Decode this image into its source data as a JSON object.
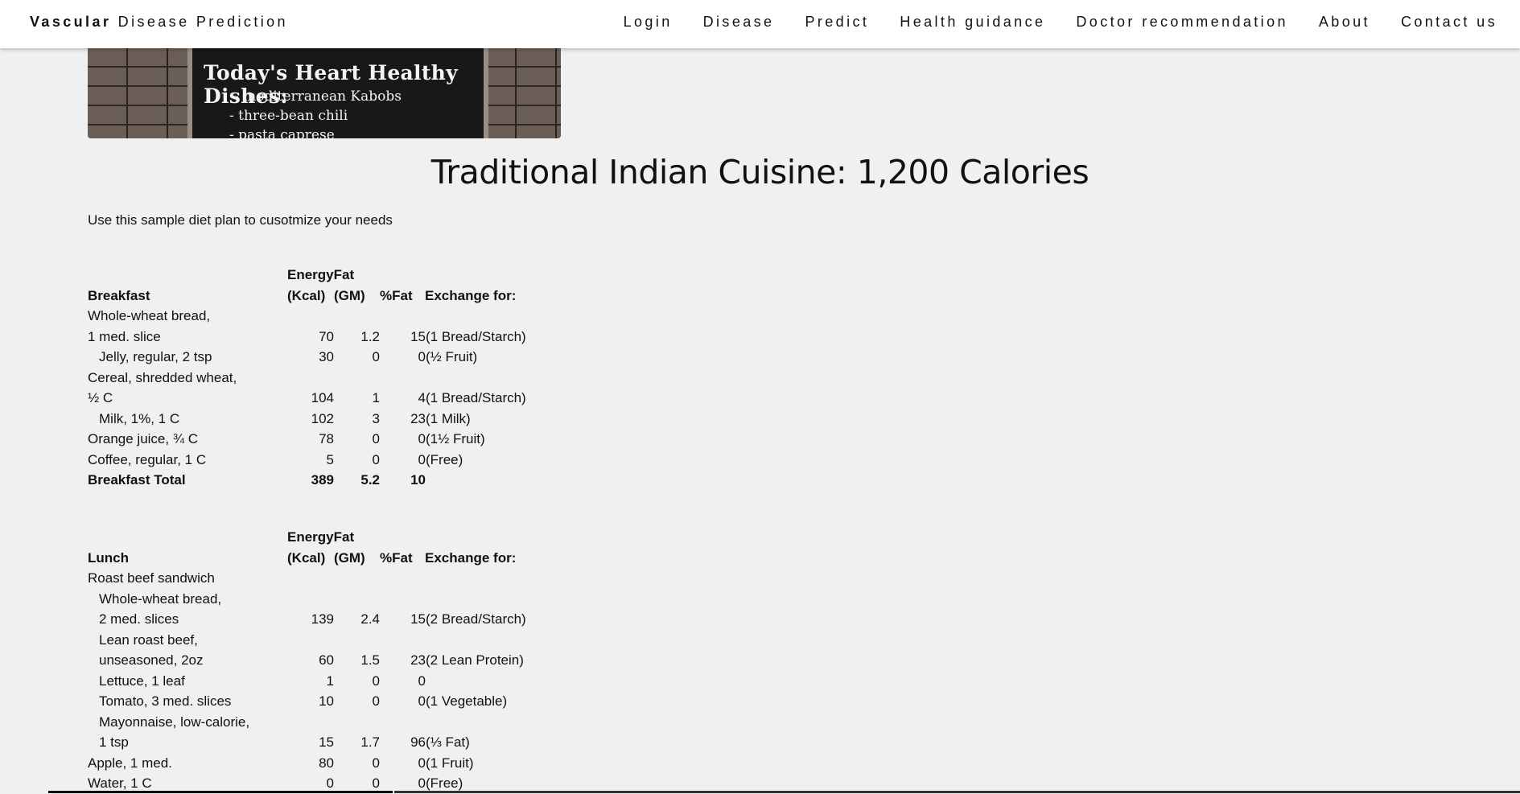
{
  "navbar": {
    "brand_bold": "Vascular",
    "brand_rest": " Disease Prediction",
    "links": [
      "Login",
      "Disease",
      "Predict",
      "Health guidance",
      "Doctor recommendation",
      "About",
      "Contact us"
    ]
  },
  "hero": {
    "title": "Today's Heart Healthy Dishes:",
    "items": [
      "- mediterranean Kabobs",
      "- three-bean chili",
      "- pasta caprese"
    ]
  },
  "page": {
    "title": "Traditional Indian Cuisine: 1,200 Calories",
    "intro": "Use this sample diet plan to cusotmize your needs"
  },
  "headers": {
    "energy_fat": "EnergyFat",
    "kcal": "(Kcal)",
    "gm": "(GM)",
    "pct_fat": "%Fat",
    "exchange": "Exchange for:"
  },
  "breakfast": {
    "label": "Breakfast",
    "rows": [
      {
        "name": "Whole-wheat bread,",
        "indent": false,
        "kcal": "",
        "fat": "",
        "pct": "",
        "ex": ""
      },
      {
        "name": "1 med. slice",
        "indent": false,
        "kcal": "70",
        "fat": "1.2",
        "pct": "15",
        "ex": "(1 Bread/Starch)"
      },
      {
        "name": "Jelly, regular, 2 tsp",
        "indent": true,
        "kcal": "30",
        "fat": "0",
        "pct": "0",
        "ex": "(½ Fruit)"
      },
      {
        "name": "Cereal, shredded wheat,",
        "indent": false,
        "kcal": "",
        "fat": "",
        "pct": "",
        "ex": ""
      },
      {
        "name": "½ C",
        "indent": false,
        "kcal": "104",
        "fat": "1",
        "pct": "4",
        "ex": "(1 Bread/Starch)"
      },
      {
        "name": "Milk, 1%, 1 C",
        "indent": true,
        "kcal": "102",
        "fat": "3",
        "pct": "23",
        "ex": "(1 Milk)"
      },
      {
        "name": "Orange juice, ¾ C",
        "indent": false,
        "kcal": "78",
        "fat": "0",
        "pct": "0",
        "ex": "(1½ Fruit)"
      },
      {
        "name": "Coffee, regular, 1 C",
        "indent": false,
        "kcal": "5",
        "fat": "0",
        "pct": "0",
        "ex": "(Free)"
      }
    ],
    "total": {
      "name": "Breakfast Total",
      "kcal": "389",
      "fat": "5.2",
      "pct": "10"
    }
  },
  "lunch": {
    "label": "Lunch",
    "rows": [
      {
        "name": "Roast beef sandwich",
        "indent": false,
        "kcal": "",
        "fat": "",
        "pct": "",
        "ex": ""
      },
      {
        "name": "Whole-wheat bread,",
        "indent": true,
        "kcal": "",
        "fat": "",
        "pct": "",
        "ex": ""
      },
      {
        "name": "2 med. slices",
        "indent": true,
        "kcal": "139",
        "fat": "2.4",
        "pct": "15",
        "ex": "(2 Bread/Starch)"
      },
      {
        "name": "Lean roast beef,",
        "indent": true,
        "kcal": "",
        "fat": "",
        "pct": "",
        "ex": ""
      },
      {
        "name": "unseasoned, 2oz",
        "indent": true,
        "kcal": "60",
        "fat": "1.5",
        "pct": "23",
        "ex": "(2 Lean Protein)"
      },
      {
        "name": "Lettuce, 1 leaf",
        "indent": true,
        "kcal": "1",
        "fat": "0",
        "pct": "0",
        "ex": ""
      },
      {
        "name": "Tomato, 3 med. slices",
        "indent": true,
        "kcal": "10",
        "fat": "0",
        "pct": "0",
        "ex": "(1 Vegetable)"
      },
      {
        "name": "Mayonnaise, low-calorie,",
        "indent": true,
        "kcal": "",
        "fat": "",
        "pct": "",
        "ex": ""
      },
      {
        "name": "1 tsp",
        "indent": true,
        "kcal": "15",
        "fat": "1.7",
        "pct": "96",
        "ex": "(⅓ Fat)"
      },
      {
        "name": "Apple, 1 med.",
        "indent": false,
        "kcal": "80",
        "fat": "0",
        "pct": "0",
        "ex": "(1 Fruit)"
      },
      {
        "name": "Water, 1 C",
        "indent": false,
        "kcal": "0",
        "fat": "0",
        "pct": "0",
        "ex": "(Free)"
      }
    ]
  }
}
